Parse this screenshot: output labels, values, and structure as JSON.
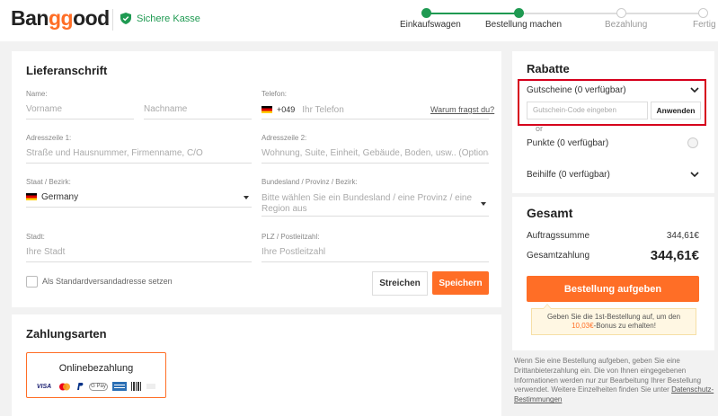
{
  "header": {
    "logo": {
      "pre": "Ban",
      "accent": "gg",
      "post": "ood"
    },
    "secure_label": "Sichere Kasse",
    "steps": [
      {
        "label": "Einkaufswagen",
        "done": true
      },
      {
        "label": "Bestellung machen",
        "done": true
      },
      {
        "label": "Bezahlung",
        "done": false
      },
      {
        "label": "Fertig",
        "done": false
      }
    ]
  },
  "address": {
    "title": "Lieferanschrift",
    "name_label": "Name:",
    "first_name_placeholder": "Vorname",
    "last_name_placeholder": "Nachname",
    "phone_label": "Telefon:",
    "phone_code": "+049",
    "phone_placeholder": "Ihr Telefon",
    "why_link": "Warum fragst du?",
    "addr1_label": "Adresszeile 1:",
    "addr1_placeholder": "Straße und Hausnummer, Firmenname, C/O",
    "addr2_label": "Adresszeile 2:",
    "addr2_placeholder": "Wohnung, Suite, Einheit, Gebäude, Boden, usw.. (Optional)",
    "country_label": "Staat / Bezirk:",
    "country_value": "Germany",
    "state_label": "Bundesland / Provinz / Bezirk:",
    "state_placeholder_line1": "Bitte wählen Sie ein Bundesland / eine Provinz / eine",
    "state_placeholder_line2": "Region aus",
    "city_label": "Stadt:",
    "city_placeholder": "Ihre Stadt",
    "zip_label": "PLZ / Postleitzahl:",
    "zip_placeholder": "Ihre Postleitzahl",
    "default_checkbox_label": "Als Standardversandadresse setzen",
    "cancel_button": "Streichen",
    "save_button": "Speichern"
  },
  "payment": {
    "title": "Zahlungsarten",
    "online_label": "Onlinebezahlung",
    "icons": [
      "visa-icon",
      "mastercard-icon",
      "paypal-icon",
      "google-pay-icon",
      "bank-transfer-icon",
      "boleto-icon",
      "more-icon"
    ],
    "visa_text": "VISA",
    "gpay_text": "G Pay"
  },
  "rabatte": {
    "title": "Rabatte",
    "coupons_label": "Gutscheine (0 verfügbar)",
    "coupon_placeholder": "Gutschein-Code eingeben",
    "apply_button": "Anwenden",
    "or_text": "or",
    "points_label": "Punkte (0 verfügbar)",
    "allowance_label": "Beihilfe (0 verfügbar)"
  },
  "gesamt": {
    "title": "Gesamt",
    "subtotal_label": "Auftragssumme",
    "subtotal_value": "344,61€",
    "total_label": "Gesamtzahlung",
    "total_value": "344,61€",
    "place_order_button": "Bestellung aufgeben",
    "bonus_pre": "Geben Sie die 1st-Bestellung auf, um den",
    "bonus_amount": "10,03€",
    "bonus_post": "-Bonus zu erhalten!"
  },
  "note": {
    "text": "Wenn Sie eine Bestellung aufgeben, geben Sie eine Drittanbieterzahlung ein. Die von Ihnen eingegebenen Informationen werden nur zur Bearbeitung Ihrer Bestellung verwendet. Weitere Einzelheiten finden Sie unter",
    "link": "Datenschutz-Bestimmungen"
  },
  "colors": {
    "brand": "#ff6e26",
    "secure_green": "#1f9a52",
    "highlight_red": "#d6001c"
  }
}
